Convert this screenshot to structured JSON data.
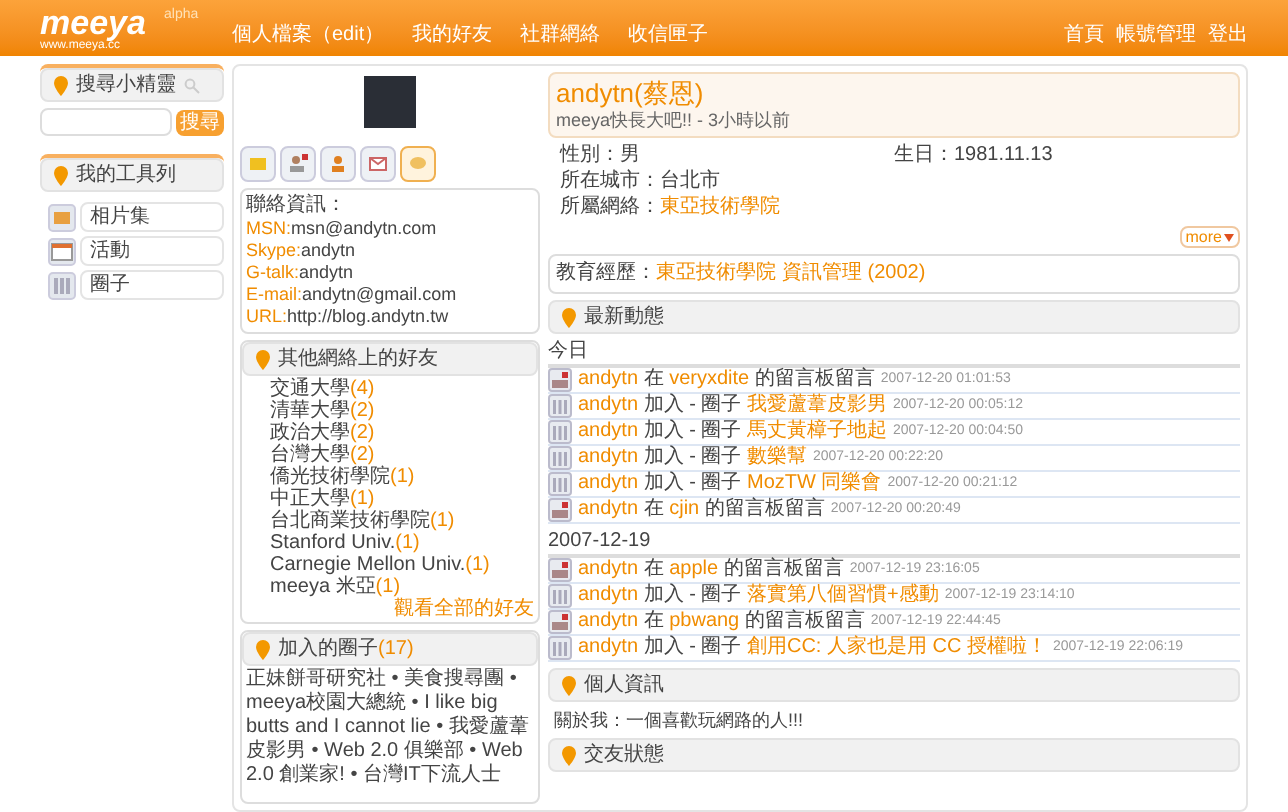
{
  "header": {
    "logo": "meeya",
    "logo_badge": "alpha",
    "logo_url": "www.meeya.cc",
    "nav": [
      {
        "label": "個人檔案（edit）"
      },
      {
        "label": "我的好友"
      },
      {
        "label": "社群網絡"
      },
      {
        "label": "收信匣子"
      }
    ],
    "account_links": [
      {
        "label": "首頁"
      },
      {
        "label": "帳號管理"
      },
      {
        "label": "登出"
      }
    ]
  },
  "sidebar": {
    "search_title": "搜尋小精靈",
    "search_button": "搜尋",
    "tools_title": "我的工具列",
    "tools": [
      {
        "kind": "photos",
        "label": "相片集"
      },
      {
        "kind": "events",
        "label": "活動"
      },
      {
        "kind": "groups",
        "label": "圈子"
      }
    ]
  },
  "profile_card": {
    "action_icons": [
      {
        "kind": "message",
        "selected": false
      },
      {
        "kind": "add_friend",
        "selected": false
      },
      {
        "kind": "person",
        "selected": false
      },
      {
        "kind": "mail",
        "selected": false
      },
      {
        "kind": "chat",
        "selected": true
      }
    ],
    "contact_title": "聯絡資訊：",
    "contacts": [
      {
        "label": "MSN:",
        "value": "msn@andytn.com"
      },
      {
        "label": "Skype:",
        "value": "andytn"
      },
      {
        "label": "G-talk:",
        "value": "andytn"
      },
      {
        "label": "E-mail:",
        "value": "andytn@gmail.com"
      },
      {
        "label": "URL:",
        "value": "http://blog.andytn.tw"
      }
    ]
  },
  "friends": {
    "title": "其他網絡上的好友",
    "networks": [
      {
        "name": "交通大學",
        "count": "(4)"
      },
      {
        "name": "清華大學",
        "count": "(2)"
      },
      {
        "name": "政治大學",
        "count": "(2)"
      },
      {
        "name": "台灣大學",
        "count": "(2)"
      },
      {
        "name": "僑光技術學院",
        "count": "(1)"
      },
      {
        "name": "中正大學",
        "count": "(1)"
      },
      {
        "name": "台北商業技術學院",
        "count": "(1)"
      },
      {
        "name": "Stanford Univ.",
        "count": "(1)"
      },
      {
        "name": "Carnegie Mellon Univ.",
        "count": "(1)"
      },
      {
        "name": "meeya 米亞",
        "count": "(1)"
      }
    ],
    "view_all": "觀看全部的好友"
  },
  "groups": {
    "title": "加入的圈子",
    "count": "(17)",
    "text": "正妹餅哥研究社 • 美食搜尋團 • meeya校園大總統 • I like big butts and I cannot lie • 我愛蘆葦皮影男 • Web 2.0 俱樂部 • Web 2.0 創業家! • 台灣IT下流人士"
  },
  "profile": {
    "name": "andytn(蔡恩)",
    "status": "meeya快長大吧!! - 3小時以前",
    "fields": [
      {
        "label": "性別：",
        "value": "男",
        "kind": "text"
      },
      {
        "label": "生日：",
        "value": "1981.11.13",
        "kind": "text"
      },
      {
        "label": "所在城市：",
        "value": "台北市",
        "kind": "text"
      },
      {
        "label": "所屬網絡：",
        "value": "東亞技術學院",
        "kind": "link"
      }
    ],
    "more": "more",
    "education_label": "教育經歷：",
    "education_school": "東亞技術學院 資訊管理",
    "education_year": "(2002)"
  },
  "activity": {
    "title": "最新動態",
    "days": [
      {
        "date": "今日",
        "entries": [
          {
            "kind": "message",
            "user": "andytn",
            "verb": "在",
            "target": "veryxdite",
            "suffix": "的留言板留言",
            "time": "2007-12-20 01:01:53"
          },
          {
            "kind": "group",
            "user": "andytn",
            "verb": "加入 - 圈子",
            "target": "我愛蘆葦皮影男",
            "time": "2007-12-20 00:05:12"
          },
          {
            "kind": "group",
            "user": "andytn",
            "verb": "加入 - 圈子",
            "target": "馬丈黃樟子地起",
            "time": "2007-12-20 00:04:50"
          },
          {
            "kind": "group",
            "user": "andytn",
            "verb": "加入 - 圈子",
            "target": "數樂幫",
            "time": "2007-12-20 00:22:20"
          },
          {
            "kind": "group",
            "user": "andytn",
            "verb": "加入 - 圈子",
            "target": "MozTW 同樂會",
            "time": "2007-12-20 00:21:12"
          },
          {
            "kind": "message",
            "user": "andytn",
            "verb": "在",
            "target": "cjin",
            "suffix": "的留言板留言",
            "time": "2007-12-20 00:20:49"
          }
        ]
      },
      {
        "date": "2007-12-19",
        "entries": [
          {
            "kind": "message",
            "user": "andytn",
            "verb": "在",
            "target": "apple",
            "suffix": "的留言板留言",
            "time": "2007-12-19 23:16:05"
          },
          {
            "kind": "group",
            "user": "andytn",
            "verb": "加入 - 圈子",
            "target": "落實第八個習慣+感動",
            "time": "2007-12-19 23:14:10"
          },
          {
            "kind": "message",
            "user": "andytn",
            "verb": "在",
            "target": "pbwang",
            "suffix": "的留言板留言",
            "time": "2007-12-19 22:44:45"
          },
          {
            "kind": "group",
            "user": "andytn",
            "verb": "加入 - 圈子",
            "target": "創用CC: 人家也是用 CC 授權啦！",
            "time": "2007-12-19 22:06:19"
          }
        ]
      }
    ]
  },
  "about": {
    "title": "個人資訊",
    "text": "關於我：一個喜歡玩網路的人!!!"
  },
  "relationship": {
    "title": "交友狀態"
  }
}
